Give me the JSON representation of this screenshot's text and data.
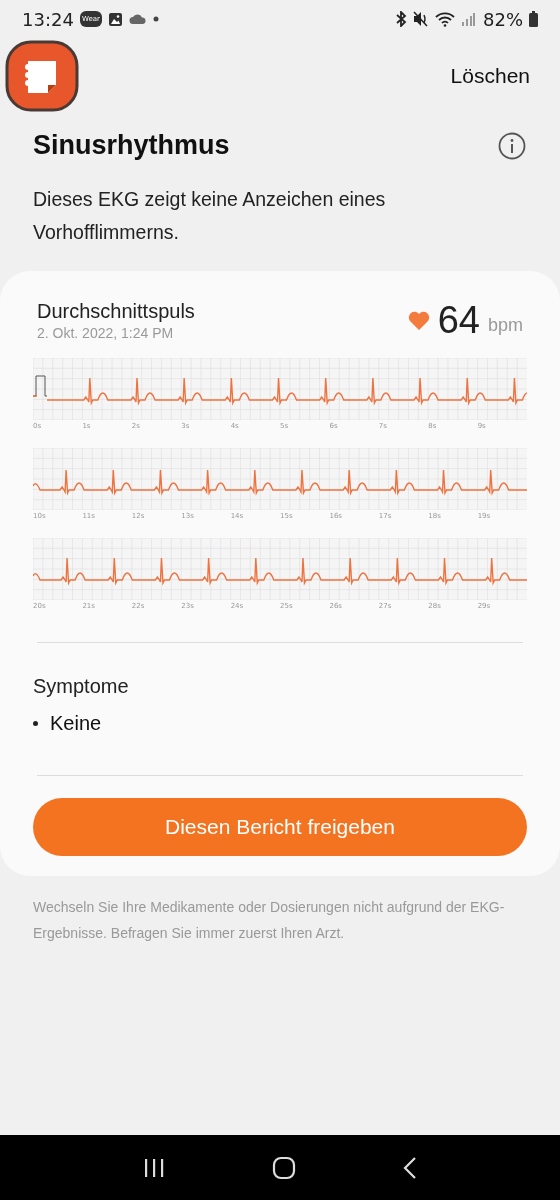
{
  "status_bar": {
    "time": "13:24",
    "wear_badge": "Wear",
    "battery": "82%"
  },
  "header": {
    "action": "Löschen"
  },
  "result": {
    "title": "Sinusrhythmus",
    "description": "Dieses EKG zeigt keine Anzeichen eines Vorhofflimmerns."
  },
  "card": {
    "label": "Durchschnittspuls",
    "date": "2. Okt. 2022, 1:24 PM",
    "heart_rate": "64",
    "unit": "bpm",
    "strips": [
      {
        "calibration": true,
        "ticks": [
          "0s",
          "1s",
          "2s",
          "3s",
          "4s",
          "5s",
          "6s",
          "7s",
          "8s",
          "9s"
        ]
      },
      {
        "calibration": false,
        "ticks": [
          "10s",
          "11s",
          "12s",
          "13s",
          "14s",
          "15s",
          "16s",
          "17s",
          "18s",
          "19s"
        ]
      },
      {
        "calibration": false,
        "ticks": [
          "20s",
          "21s",
          "22s",
          "23s",
          "24s",
          "25s",
          "26s",
          "27s",
          "28s",
          "29s"
        ]
      }
    ],
    "symptoms_title": "Symptome",
    "symptoms": [
      "Keine"
    ],
    "share_button": "Diesen Bericht freigeben"
  },
  "disclaimer": "Wechseln Sie Ihre Medikamente oder Dosierungen nicht aufgrund der EKG-Ergebnisse. Befragen Sie immer zuerst Ihren Arzt."
}
